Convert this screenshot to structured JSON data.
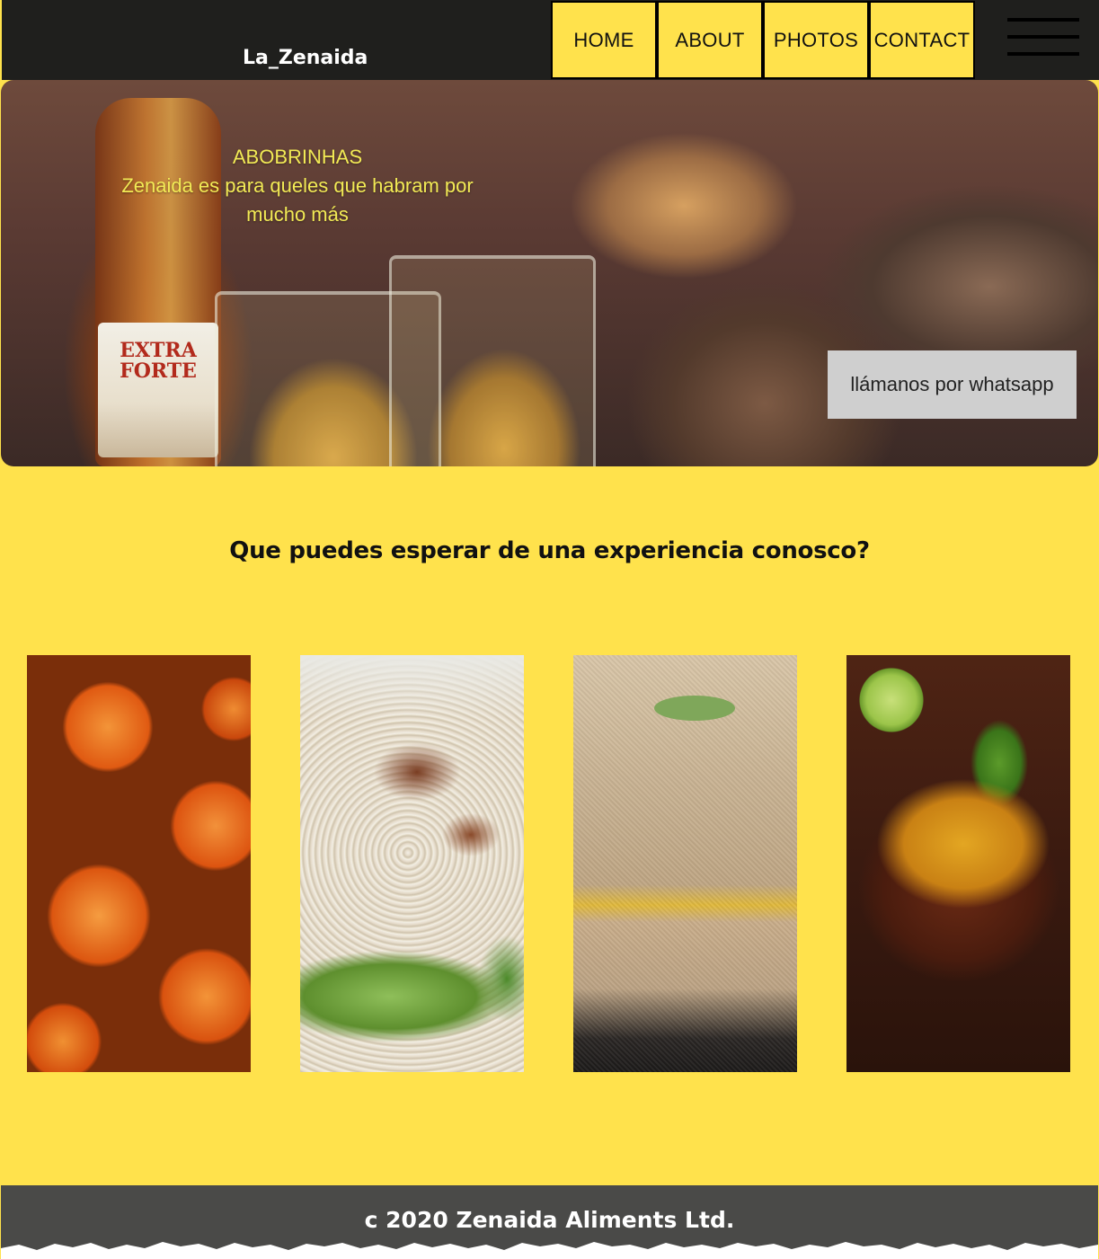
{
  "header": {
    "brand": "La_Zenaida",
    "nav": [
      {
        "label": "HOME"
      },
      {
        "label": "ABOUT"
      },
      {
        "label": "PHOTOS"
      },
      {
        "label": "CONTACT"
      }
    ],
    "menu_icon": "hamburger-menu-icon"
  },
  "hero": {
    "caption_title": "ABOBRINHAS",
    "caption_body": "Zenaida es para queles que habram por mucho más",
    "bottle_label": "EXTRA FORTE",
    "whatsapp_button": "llámanos por whatsapp"
  },
  "main": {
    "title": "Que puedes esperar de una experiencia conosco?",
    "photos": [
      {
        "subject": "fried-balls"
      },
      {
        "subject": "fried-rice"
      },
      {
        "subject": "breaded-dish"
      },
      {
        "subject": "mussel-soup"
      }
    ]
  },
  "footer": {
    "copyright": "c 2020 Zenaida Aliments Ltd."
  },
  "colors": {
    "accent": "#ffe24c",
    "nav_bg": "#1f1f1d",
    "footer_bg": "#4a4a48",
    "button_bg": "#cfcfcf",
    "caption": "#f2ea55"
  }
}
